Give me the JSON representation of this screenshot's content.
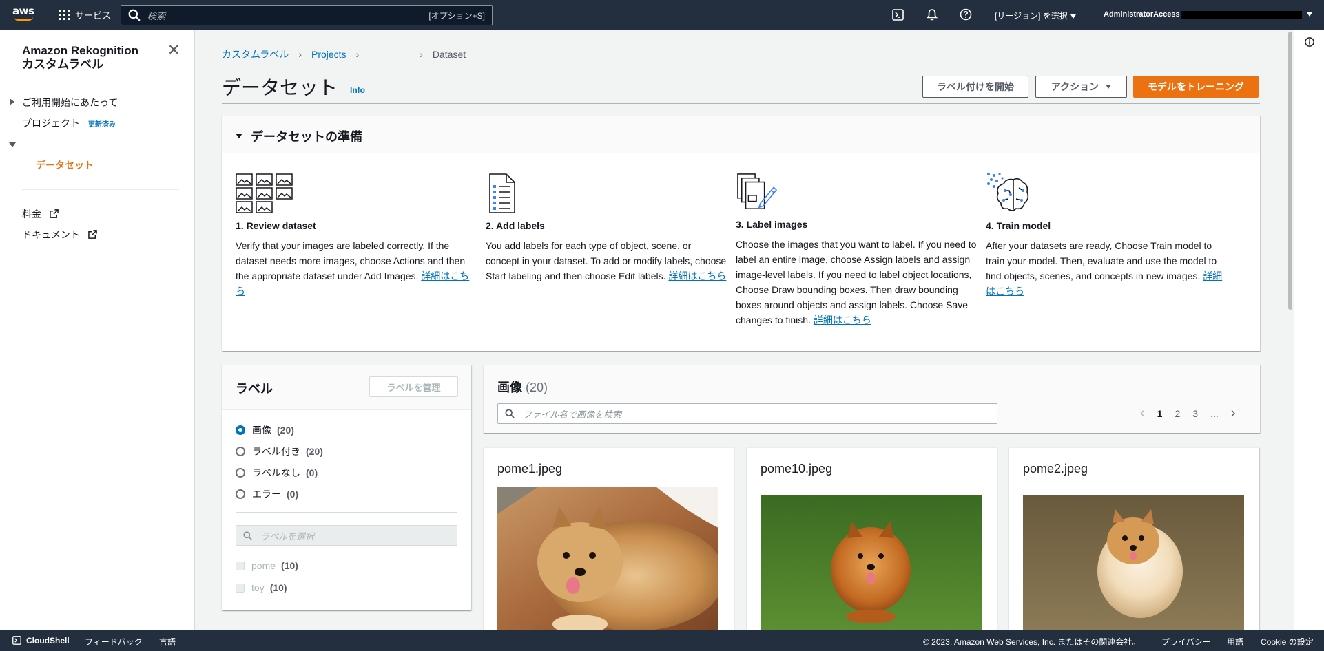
{
  "topnav": {
    "logo": "aws",
    "services": "サービス",
    "search_placeholder": "検索",
    "search_shortcut": "[オプション+S]",
    "region": "[リージョン] を選択",
    "account": "AdministratorAccess"
  },
  "sidebar": {
    "title_line1": "Amazon Rekognition",
    "title_line2": "カスタムラベル",
    "getting_started": "ご利用開始にあたって",
    "projects": "プロジェクト",
    "projects_badge": "更新済み",
    "dataset": "データセット",
    "pricing": "料金",
    "documentation": "ドキュメント"
  },
  "breadcrumb": {
    "item1": "カスタムラベル",
    "item2": "Projects",
    "item3": "Dataset"
  },
  "header": {
    "title": "データセット",
    "info": "Info",
    "start_labeling": "ラベル付けを開始",
    "actions": "アクション",
    "train_model": "モデルをトレーニング"
  },
  "prep": {
    "title": "データセットの準備",
    "steps": [
      {
        "icon": "images-grid-icon",
        "title": "1. Review dataset",
        "text": "Verify that your images are labeled correctly. If the dataset needs more images, choose Actions and then the appropriate dataset under Add Images. ",
        "link": "詳細はこちら"
      },
      {
        "icon": "document-list-icon",
        "title": "2. Add labels",
        "text": "You add labels for each type of object, scene, or concept in your dataset. To add or modify labels, choose Start labeling and then choose Edit labels. ",
        "link": "詳細はこちら"
      },
      {
        "icon": "label-images-icon",
        "title": "3. Label images",
        "text": "Choose the images that you want to label. If you need to label an entire image, choose Assign labels and assign image-level labels. If you need to label object locations, Choose Draw bounding boxes. Then draw bounding boxes around objects and assign labels. Choose Save changes to finish. ",
        "link": "詳細はこちら"
      },
      {
        "icon": "brain-model-icon",
        "title": "4. Train model",
        "text": "After your datasets are ready, Choose Train model to train your model. Then, evaluate and use the model to find objects, scenes, and concepts in new images. ",
        "link": "詳細はこちら"
      }
    ]
  },
  "labels_panel": {
    "title": "ラベル",
    "manage": "ラベルを管理",
    "filters": [
      {
        "label": "画像",
        "count": "(20)",
        "selected": true
      },
      {
        "label": "ラベル付き",
        "count": "(20)",
        "selected": false
      },
      {
        "label": "ラベルなし",
        "count": "(0)",
        "selected": false
      },
      {
        "label": "エラー",
        "count": "(0)",
        "selected": false
      }
    ],
    "search_placeholder": "ラベルを選択",
    "labels": [
      {
        "name": "pome",
        "count": "(10)"
      },
      {
        "name": "toy",
        "count": "(10)"
      }
    ]
  },
  "images_panel": {
    "title": "画像",
    "count": "(20)",
    "search_placeholder": "ファイル名で画像を検索",
    "pages": [
      "1",
      "2",
      "3",
      "..."
    ],
    "cards": [
      {
        "filename": "pome1.jpeg"
      },
      {
        "filename": "pome10.jpeg"
      },
      {
        "filename": "pome2.jpeg"
      }
    ]
  },
  "footer": {
    "cloudshell": "CloudShell",
    "feedback": "フィードバック",
    "language": "言語",
    "copyright": "© 2023, Amazon Web Services, Inc. またはその関連会社。",
    "privacy": "プライバシー",
    "terms": "用語",
    "cookies": "Cookie の設定"
  },
  "colors": {
    "nav_bg": "#232f3e",
    "primary": "#ec7211",
    "link": "#0073bb"
  }
}
